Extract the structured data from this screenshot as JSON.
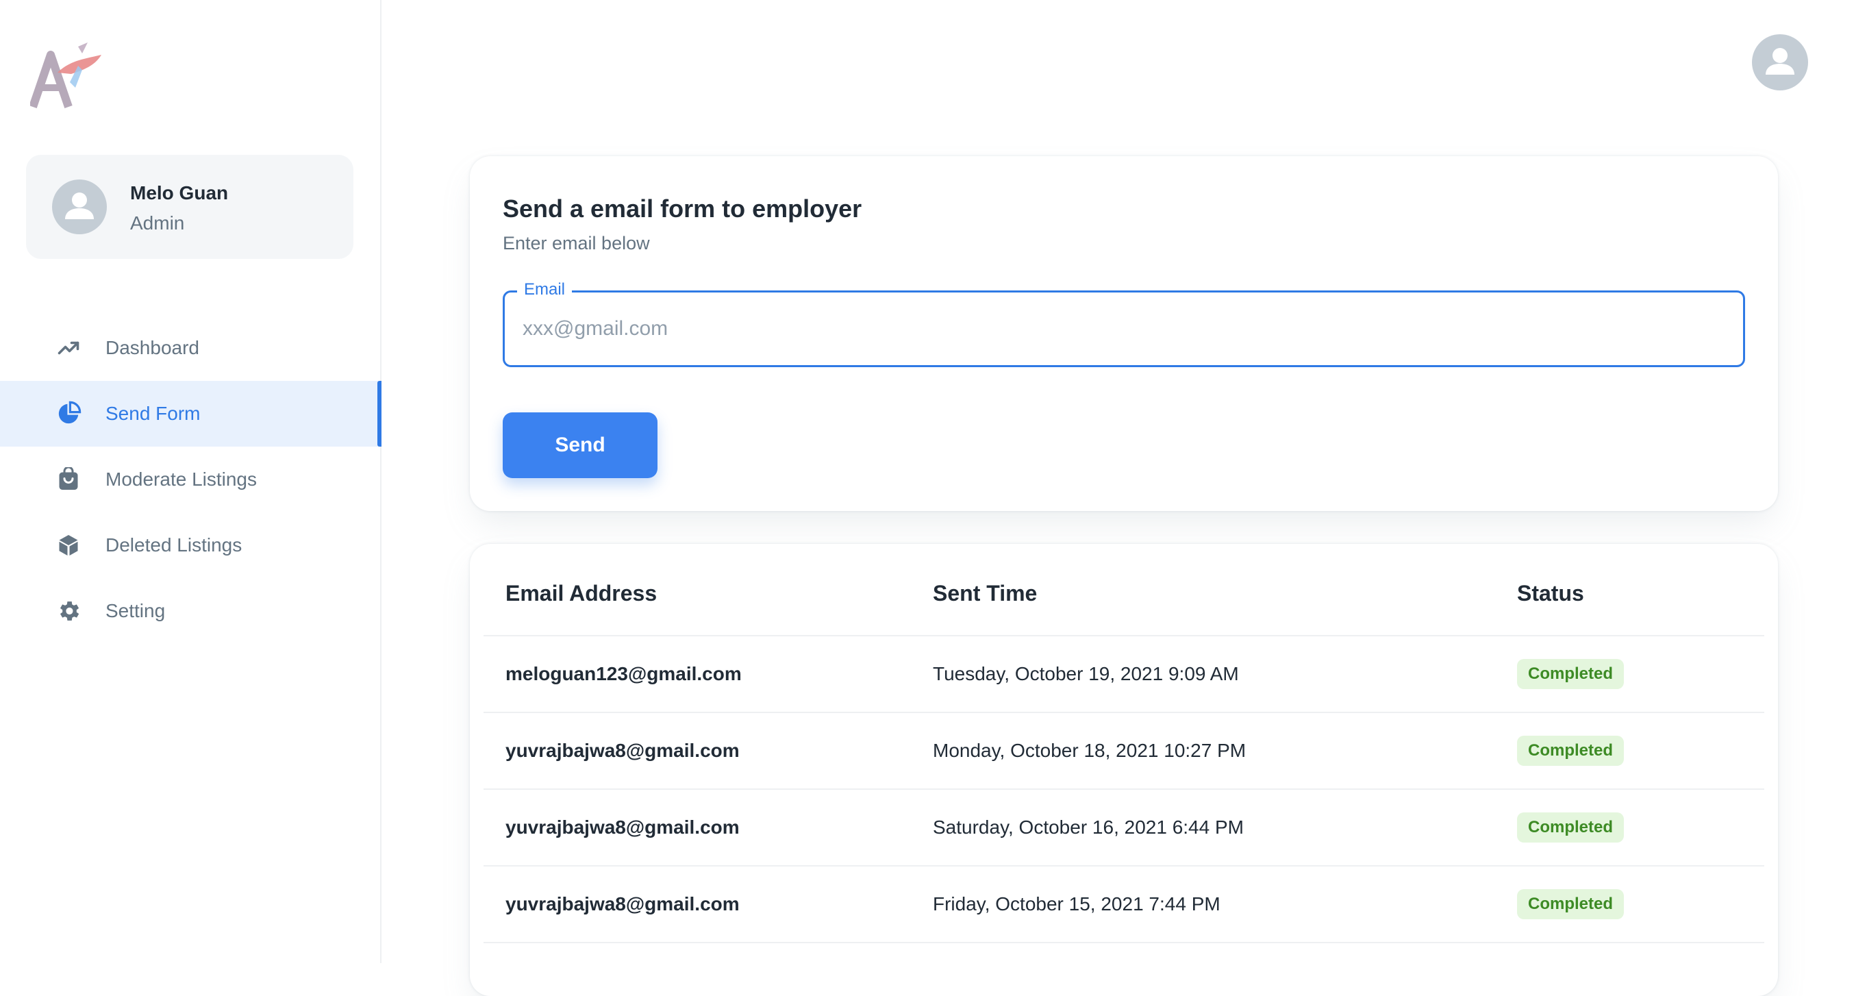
{
  "account": {
    "name": "Melo Guan",
    "role": "Admin"
  },
  "nav": {
    "items": [
      {
        "label": "Dashboard",
        "icon": "trending-up-icon"
      },
      {
        "label": "Send Form",
        "icon": "pie-chart-icon",
        "active": true
      },
      {
        "label": "Moderate Listings",
        "icon": "shopping-bag-icon"
      },
      {
        "label": "Deleted Listings",
        "icon": "cube-icon"
      },
      {
        "label": "Setting",
        "icon": "gear-icon"
      }
    ]
  },
  "form": {
    "title": "Send a email form to employer",
    "subtitle": "Enter email below",
    "email_label": "Email",
    "email_placeholder": "xxx@gmail.com",
    "email_value": "",
    "send_label": "Send"
  },
  "table": {
    "headers": {
      "email": "Email Address",
      "time": "Sent Time",
      "status": "Status"
    },
    "rows": [
      {
        "email": "meloguan123@gmail.com",
        "time": "Tuesday, October 19, 2021 9:09 AM",
        "status": "Completed"
      },
      {
        "email": "yuvrajbajwa8@gmail.com",
        "time": "Monday, October 18, 2021 10:27 PM",
        "status": "Completed"
      },
      {
        "email": "yuvrajbajwa8@gmail.com",
        "time": "Saturday, October 16, 2021 6:44 PM",
        "status": "Completed"
      },
      {
        "email": "yuvrajbajwa8@gmail.com",
        "time": "Friday, October 15, 2021 7:44 PM",
        "status": "Completed"
      }
    ]
  },
  "colors": {
    "accent": "#2f7ae5",
    "status_completed_bg": "#e4f6dd",
    "status_completed_text": "#3d8b25"
  }
}
